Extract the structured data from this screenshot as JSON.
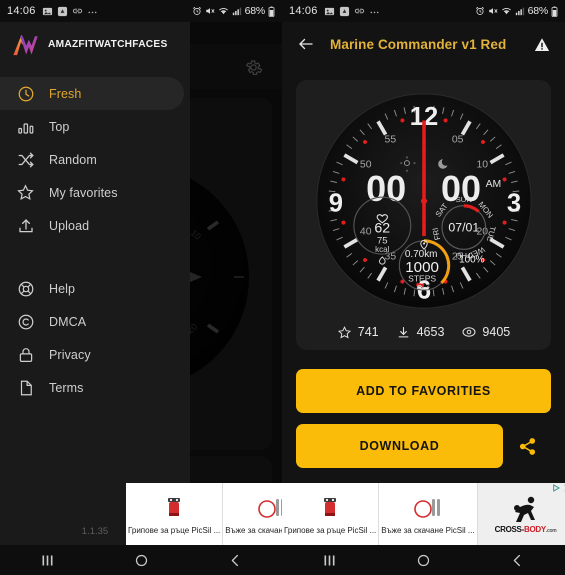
{
  "status_bar": {
    "time": "14:06",
    "battery": "68%",
    "left_icons": [
      "image-icon",
      "play-store-icon",
      "link-icon",
      "more-icon"
    ],
    "right_icons": [
      "alarm-icon",
      "mute-icon",
      "wifi-icon",
      "signal-icon",
      "battery-icon"
    ]
  },
  "left_screen": {
    "app_bar": {
      "brand": "AMAZFITWATCHFACES",
      "logo": "aw-logo",
      "settings_icon": "gear-icon"
    },
    "drawer": {
      "items": [
        {
          "label": "Fresh",
          "icon": "clock-icon",
          "active": true
        },
        {
          "label": "Top",
          "icon": "bar-chart-icon",
          "active": false
        },
        {
          "label": "Random",
          "icon": "shuffle-icon",
          "active": false
        },
        {
          "label": "My favorites",
          "icon": "star-icon",
          "active": false
        },
        {
          "label": "Upload",
          "icon": "upload-icon",
          "active": false
        }
      ],
      "secondary_items": [
        {
          "label": "Help",
          "icon": "lifebuoy-icon"
        },
        {
          "label": "DMCA",
          "icon": "copyright-icon"
        },
        {
          "label": "Privacy",
          "icon": "lock-icon"
        },
        {
          "label": "Terms",
          "icon": "document-icon"
        }
      ],
      "version": "1.1.35"
    }
  },
  "right_screen": {
    "app_bar": {
      "back_icon": "arrow-left-icon",
      "title": "Marine Commander v1 Red",
      "report_icon": "warning-triangle-icon",
      "title_color": "#e3b23c"
    },
    "stats": [
      {
        "icon": "star-icon",
        "value": "741"
      },
      {
        "icon": "download-icon",
        "value": "4653"
      },
      {
        "icon": "eye-icon",
        "value": "9405"
      }
    ],
    "buttons": {
      "favorite_label": "ADD TO FAVORITIES",
      "download_label": "DOWNLOAD",
      "share_icon": "share-icon",
      "accent_color": "#FBBC09"
    }
  },
  "watch_face": {
    "name": "Marine Commander v1 Red",
    "time": "00:00",
    "ampm": "AM",
    "hour_numerals": [
      "12",
      "3",
      "6",
      "9"
    ],
    "minute_numerals": [
      "05",
      "10",
      "20",
      "25",
      "35",
      "40",
      "50",
      "55"
    ],
    "heart_dial": {
      "icon": "heart-icon",
      "bpm": "62",
      "calories": "75",
      "calories_unit": "kcal",
      "bottom_icon": "flame-icon"
    },
    "date_dial": {
      "date": "07/01",
      "weekdays": [
        "SUN",
        "MON",
        "TUE",
        "WED",
        "THU",
        "FRI",
        "SAT"
      ],
      "active_day": "MON",
      "marker_color": "#e02222"
    },
    "steps_dial": {
      "icon": "location-icon",
      "distance": "0.70km",
      "steps": "1000",
      "steps_label": "STEPS",
      "battery": "100%",
      "arc_color": "#f0a010",
      "bottom_icons": [
        "shoe-icon",
        "bolt-icon"
      ]
    },
    "accent_red": "#e41c1c"
  },
  "ads": {
    "items": [
      {
        "text": "Грипове за ръце PicSil ...",
        "art": "grips-art"
      },
      {
        "text": "Въже за скачане PicSil ...",
        "art": "rope-art"
      }
    ],
    "brand": {
      "name": "CROSS-BODY",
      "suffix": ".com",
      "art": "athlete-silhouette",
      "mark": "adchoices-icon",
      "close": "close-icon"
    }
  },
  "nav_bar": {
    "recents": "recents-icon",
    "home": "home-icon",
    "back": "back-icon"
  }
}
